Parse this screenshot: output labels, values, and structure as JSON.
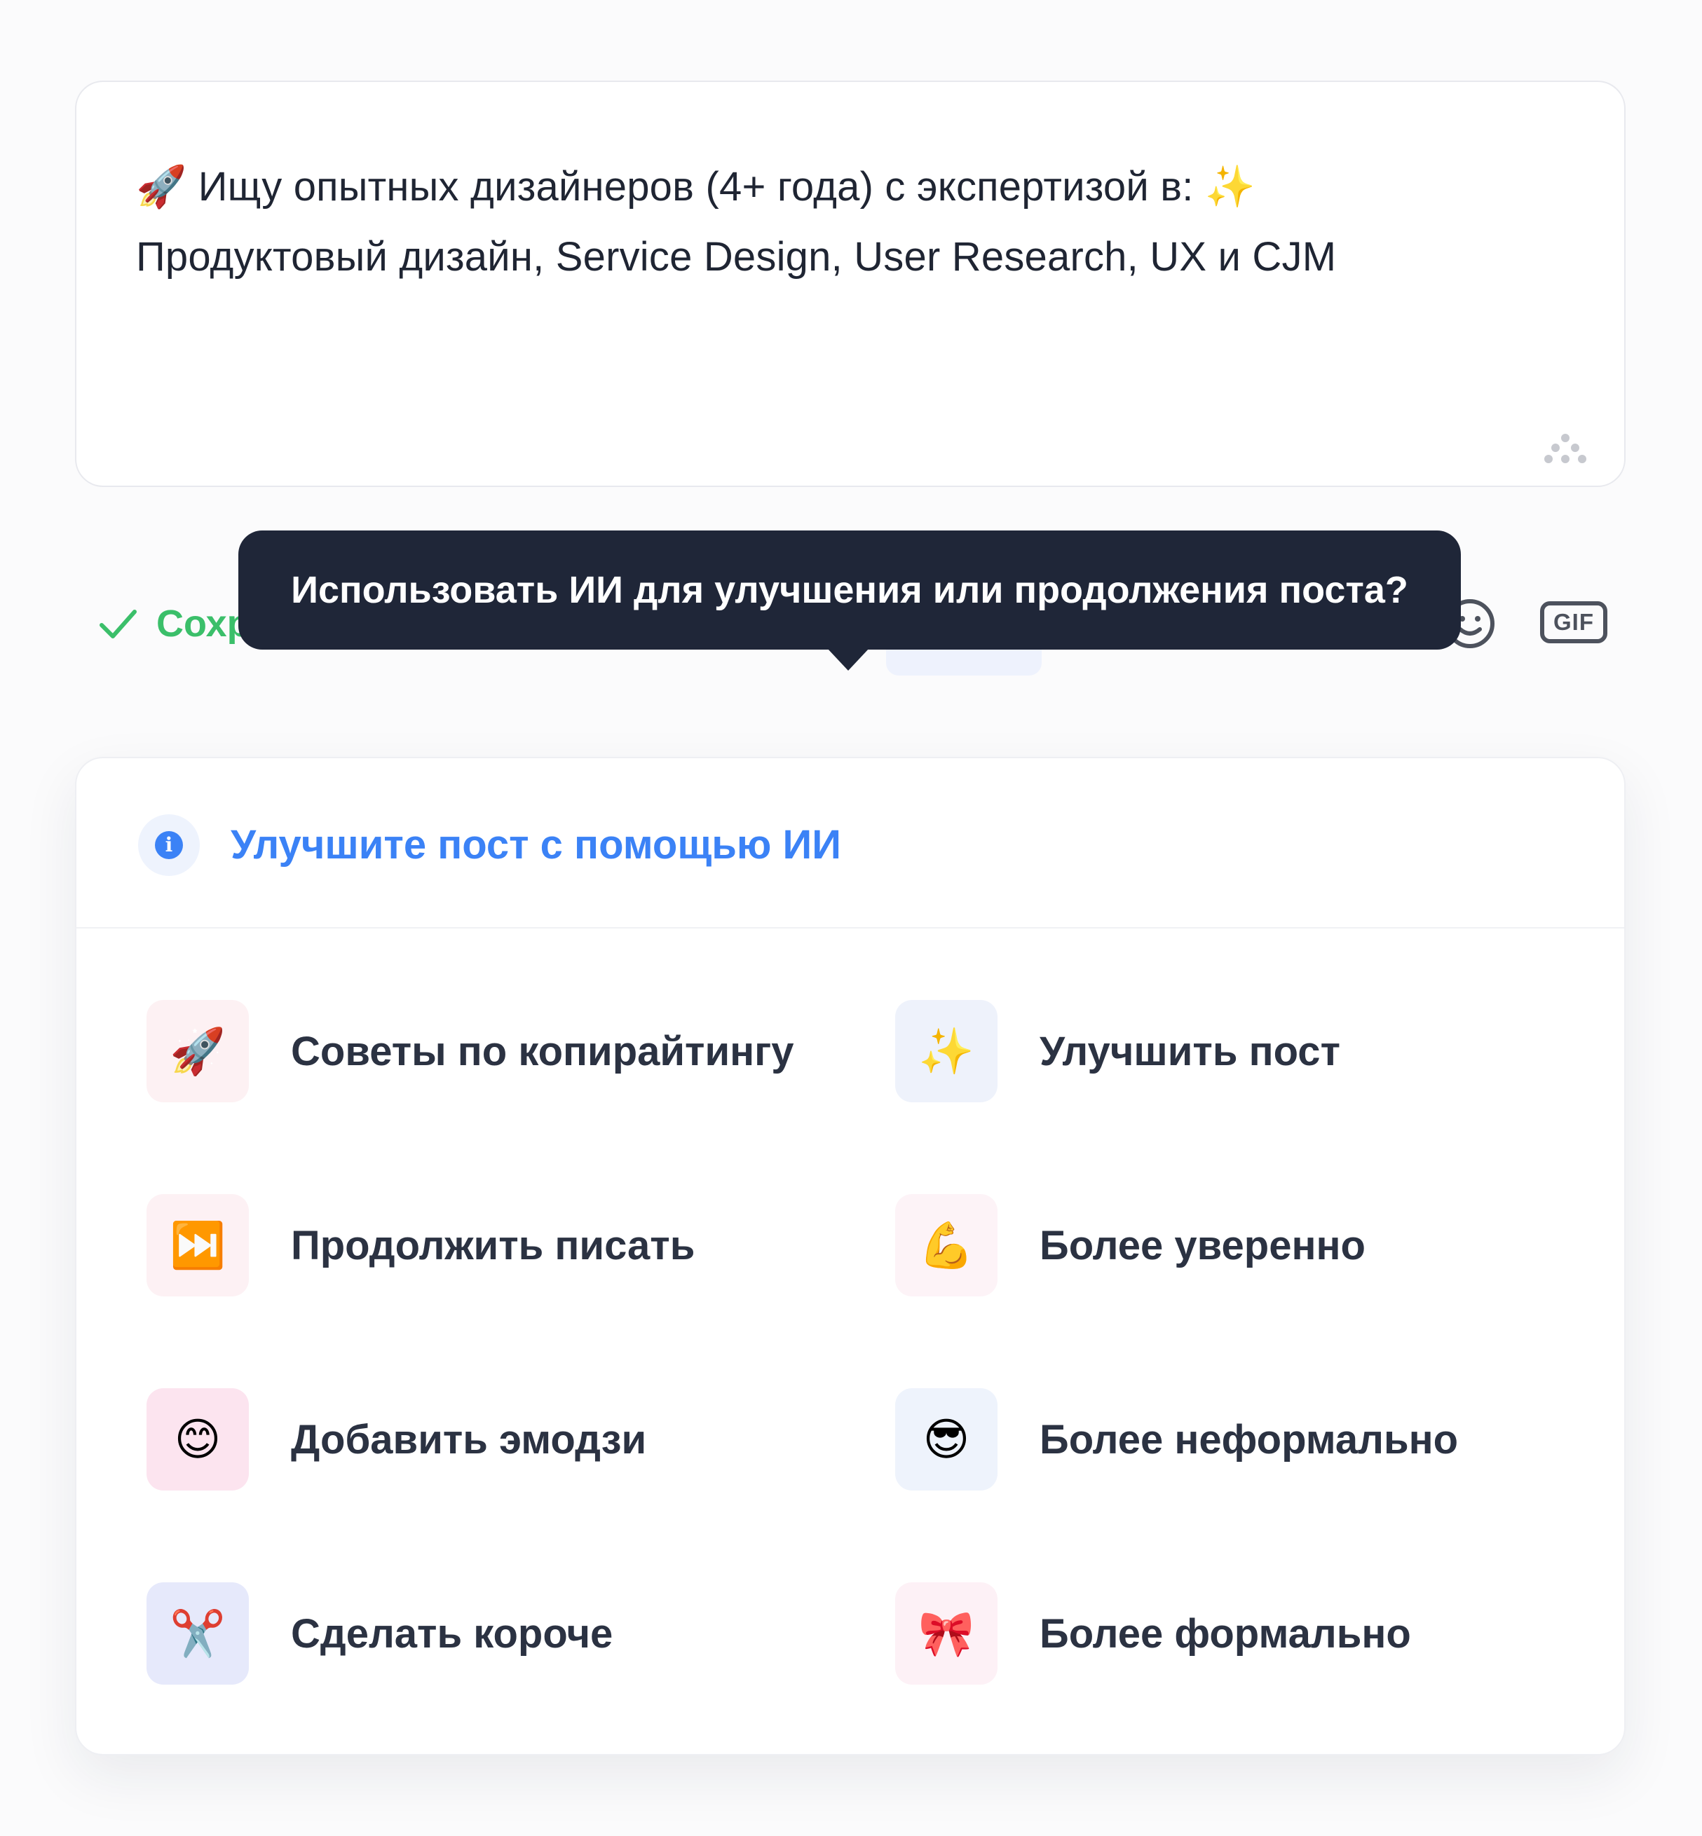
{
  "editor": {
    "text_line1": "🚀 Ищу опытных дизайнеров (4+ года) с экспертизой в: ✨",
    "text_line2": "Продуктовый дизайн, Service Design, User Research, UX и CJM"
  },
  "toolbar": {
    "saved_label": "Сохр",
    "gif_label": "GIF"
  },
  "tooltip": {
    "text": "Использовать ИИ для улучшения или продолжения поста?"
  },
  "panel": {
    "info_glyph": "i",
    "title": "Улучшите пост с помощью ИИ",
    "options": [
      {
        "icon": "🚀",
        "icon_name": "rocket-icon",
        "label": "Советы по копирайтингу",
        "bg": "#fdf1f3"
      },
      {
        "icon": "✨",
        "icon_name": "sparkles-icon",
        "label": "Улучшить пост",
        "bg": "#eef2fb"
      },
      {
        "icon": "⏭️",
        "icon_name": "fast-forward-icon",
        "label": "Продолжить писать",
        "bg": "#fdf1f4"
      },
      {
        "icon": "💪",
        "icon_name": "flexed-biceps-icon",
        "label": "Более уверенно",
        "bg": "#fdf3f7"
      },
      {
        "icon": "😊",
        "icon_name": "smiling-face-icon",
        "label": "Добавить эмодзи",
        "bg": "#fce4ef"
      },
      {
        "icon": "😎",
        "icon_name": "sunglasses-face-icon",
        "label": "Более неформально",
        "bg": "#eef3fc"
      },
      {
        "icon": "✂️",
        "icon_name": "scissors-icon",
        "label": "Сделать короче",
        "bg": "#e6e9fb"
      },
      {
        "icon": "🎀",
        "icon_name": "ribbon-bow-icon",
        "label": "Более формально",
        "bg": "#fdf1f6"
      }
    ]
  },
  "colors": {
    "accent": "#3b82f6",
    "success": "#3bbf6a",
    "tooltip_bg": "#1f2638",
    "text": "#1f2533"
  }
}
